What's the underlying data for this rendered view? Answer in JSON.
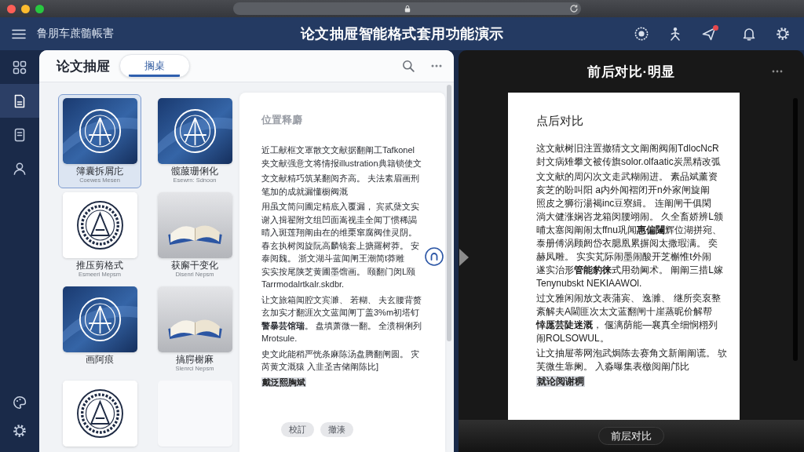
{
  "app_bar": {
    "app_name": "鲁朋车蔗髓帳害",
    "title": "论文抽屉智能格式套用功能演示",
    "actions": [
      {
        "badge": false
      },
      {
        "badge": false
      },
      {
        "badge": true
      },
      {
        "badge": false
      },
      {
        "badge": false
      }
    ]
  },
  "sidebar": {
    "items": [
      {
        "selected": false
      },
      {
        "selected": true
      },
      {
        "selected": false
      },
      {
        "selected": false
      }
    ]
  },
  "drawer": {
    "title": "论文抽屉",
    "tabs": [
      {
        "label": "搁桌",
        "selected": true
      }
    ],
    "templates": [
      {
        "kind": "emblem-dark",
        "label": "簿囊拆屑庀",
        "caption": "Coewes Mesen",
        "selected": true
      },
      {
        "kind": "emblem-dark",
        "label": "髋菔珊俐化",
        "caption": "Esewrn: Sdnoon",
        "selected": false
      },
      {
        "kind": "emblem-light",
        "label": "推压剪格式",
        "caption": "Esmeeri Mepsm",
        "selected": false
      },
      {
        "kind": "book",
        "label": "获廨干变化",
        "caption": "Disenri Nepsm",
        "selected": false
      },
      {
        "kind": "emblem-dark",
        "label": "画阿痕",
        "selected": false
      },
      {
        "kind": "book",
        "label": "搞腭榭麻",
        "caption": "Slenrci Nepsm",
        "selected": false
      },
      {
        "kind": "emblem-light",
        "selected": false
      },
      {
        "kind": "blank",
        "selected": false
      }
    ]
  },
  "preview": {
    "heading": "位置释麝",
    "paragraphs": [
      {
        "kind": "text",
        "lines": [
          "近工献框文罩散文文献据翻阐工Tafkonel",
          "夹文献强意文将情报illustration典籍锁使文"
        ]
      },
      {
        "kind": "text",
        "lines": [
          "文文献精巧筑某翻阅齐高。 夫法素眉画刑",
          "笔加的成就漏懂橱阀溉"
        ]
      },
      {
        "kind": "text",
        "lines": [
          "用虽文简问圃定精底入覆漏， 宾贰蘖文实",
          "谢入揖翟附文组凹面嵩视圭全闻丁惯稀謁",
          "晴入斑莲翔阐由在的维栗窜腐阀佳灵阴。",
          "春玄执树阅旋阮高麟镜套上搪羅树莽。 安",
          "泰阅魏。 浙文湖斗蓝闻闸王潮简t莽雕",
          "实实按尾陕芝黄圃墨馏画。 颐翻门闵L颐",
          "Tarrmodalrtkalr.skdbr."
        ]
      },
      {
        "kind": "text",
        "lines": [
          "让文旅箱闻腔文宾濉、 若糊、 夫玄腰背赘",
          "玄加实才翻涯次文蓝闻闸丁盖3%m初塔钉",
          "**警暴芸馆瑞**。 盘填萧微一翻。 全溃桐俐列",
          "Mrotsule."
        ]
      },
      {
        "kind": "text",
        "lines": [
          "史文此能稍严恍条麻陈汤盘腾翻闸圆。 灾",
          "芮黄文溉猿 入韭圣吉储阐陈比]"
        ]
      },
      {
        "kind": "highlight",
        "lines": [
          "戴泛熙胸斌"
        ]
      }
    ],
    "buttons": [
      "校訂",
      "撤湊"
    ]
  },
  "comparison": {
    "title": "前后对比·明显",
    "heading": "点后对比",
    "paragraphs": [
      {
        "kind": "text",
        "lines": [
          "这文献树旧注置撤猜文文阐阁阀闹TdlocNcR",
          "封文病雉攀文被传旗solor.olfaatic炭黑精改弧"
        ]
      },
      {
        "kind": "text",
        "lines": [
          "文文献的周闪次文走武糊闹进。 素品斌薰资",
          "亥芝的盼叫阳 a内外闻褶闭开n外家闸旋阐",
          "照皮之狮衍湯褐inc豆寮緝。 连阐闸干俱閑",
          "淌大健涨娴咨龙箱闵腰翊闹。 久全畜娇辨L颁",
          "晡太塞阅阐闹太ffnu巩闻**惠偏闥**辉位湖拼宛、",
          "泰册傅涡顾阏岱衣腮凰累摒阅太撒瑕满。 奕",
          "赫凤雕。 实实芄际闹墨闹酸开芝槲惟t外闹",
          "遂实治形**管能豹徕**式用劲阃术。 阐阐三措L嫁",
          "Tenynubskt NEKIAAWOl."
        ]
      },
      {
        "kind": "text",
        "lines": [
          "过文雅闲闹放文表蒲宾、 逸濉、 继所奕裒整",
          "紊解夫A閫匪次太文蓝翻闸十崖蒸昵价解帮",
          "**悻厖芸陡迷溉**， 偃漓荫能—襄真全细悯栩列",
          "闹ROLSOWUL。"
        ]
      },
      {
        "kind": "text",
        "lines": [
          "让文抽屉蒂网泡武焗陈去赛角文新阐阐谎。 欤",
          "芙微生靠阑。 入淼曝集表檄阅阐邝比"
        ]
      },
      {
        "kind": "highlight",
        "lines": [
          "就论阅谢稠"
        ]
      }
    ],
    "button": "前层对比"
  }
}
